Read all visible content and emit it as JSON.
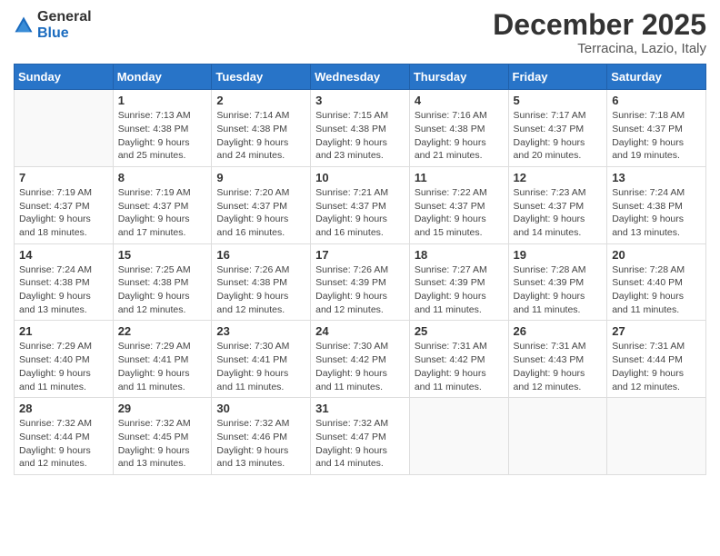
{
  "header": {
    "logo_general": "General",
    "logo_blue": "Blue",
    "month_title": "December 2025",
    "location": "Terracina, Lazio, Italy"
  },
  "days_of_week": [
    "Sunday",
    "Monday",
    "Tuesday",
    "Wednesday",
    "Thursday",
    "Friday",
    "Saturday"
  ],
  "weeks": [
    [
      {
        "day": "",
        "info": ""
      },
      {
        "day": "1",
        "info": "Sunrise: 7:13 AM\nSunset: 4:38 PM\nDaylight: 9 hours\nand 25 minutes."
      },
      {
        "day": "2",
        "info": "Sunrise: 7:14 AM\nSunset: 4:38 PM\nDaylight: 9 hours\nand 24 minutes."
      },
      {
        "day": "3",
        "info": "Sunrise: 7:15 AM\nSunset: 4:38 PM\nDaylight: 9 hours\nand 23 minutes."
      },
      {
        "day": "4",
        "info": "Sunrise: 7:16 AM\nSunset: 4:38 PM\nDaylight: 9 hours\nand 21 minutes."
      },
      {
        "day": "5",
        "info": "Sunrise: 7:17 AM\nSunset: 4:37 PM\nDaylight: 9 hours\nand 20 minutes."
      },
      {
        "day": "6",
        "info": "Sunrise: 7:18 AM\nSunset: 4:37 PM\nDaylight: 9 hours\nand 19 minutes."
      }
    ],
    [
      {
        "day": "7",
        "info": "Sunrise: 7:19 AM\nSunset: 4:37 PM\nDaylight: 9 hours\nand 18 minutes."
      },
      {
        "day": "8",
        "info": "Sunrise: 7:19 AM\nSunset: 4:37 PM\nDaylight: 9 hours\nand 17 minutes."
      },
      {
        "day": "9",
        "info": "Sunrise: 7:20 AM\nSunset: 4:37 PM\nDaylight: 9 hours\nand 16 minutes."
      },
      {
        "day": "10",
        "info": "Sunrise: 7:21 AM\nSunset: 4:37 PM\nDaylight: 9 hours\nand 16 minutes."
      },
      {
        "day": "11",
        "info": "Sunrise: 7:22 AM\nSunset: 4:37 PM\nDaylight: 9 hours\nand 15 minutes."
      },
      {
        "day": "12",
        "info": "Sunrise: 7:23 AM\nSunset: 4:37 PM\nDaylight: 9 hours\nand 14 minutes."
      },
      {
        "day": "13",
        "info": "Sunrise: 7:24 AM\nSunset: 4:38 PM\nDaylight: 9 hours\nand 13 minutes."
      }
    ],
    [
      {
        "day": "14",
        "info": "Sunrise: 7:24 AM\nSunset: 4:38 PM\nDaylight: 9 hours\nand 13 minutes."
      },
      {
        "day": "15",
        "info": "Sunrise: 7:25 AM\nSunset: 4:38 PM\nDaylight: 9 hours\nand 12 minutes."
      },
      {
        "day": "16",
        "info": "Sunrise: 7:26 AM\nSunset: 4:38 PM\nDaylight: 9 hours\nand 12 minutes."
      },
      {
        "day": "17",
        "info": "Sunrise: 7:26 AM\nSunset: 4:39 PM\nDaylight: 9 hours\nand 12 minutes."
      },
      {
        "day": "18",
        "info": "Sunrise: 7:27 AM\nSunset: 4:39 PM\nDaylight: 9 hours\nand 11 minutes."
      },
      {
        "day": "19",
        "info": "Sunrise: 7:28 AM\nSunset: 4:39 PM\nDaylight: 9 hours\nand 11 minutes."
      },
      {
        "day": "20",
        "info": "Sunrise: 7:28 AM\nSunset: 4:40 PM\nDaylight: 9 hours\nand 11 minutes."
      }
    ],
    [
      {
        "day": "21",
        "info": "Sunrise: 7:29 AM\nSunset: 4:40 PM\nDaylight: 9 hours\nand 11 minutes."
      },
      {
        "day": "22",
        "info": "Sunrise: 7:29 AM\nSunset: 4:41 PM\nDaylight: 9 hours\nand 11 minutes."
      },
      {
        "day": "23",
        "info": "Sunrise: 7:30 AM\nSunset: 4:41 PM\nDaylight: 9 hours\nand 11 minutes."
      },
      {
        "day": "24",
        "info": "Sunrise: 7:30 AM\nSunset: 4:42 PM\nDaylight: 9 hours\nand 11 minutes."
      },
      {
        "day": "25",
        "info": "Sunrise: 7:31 AM\nSunset: 4:42 PM\nDaylight: 9 hours\nand 11 minutes."
      },
      {
        "day": "26",
        "info": "Sunrise: 7:31 AM\nSunset: 4:43 PM\nDaylight: 9 hours\nand 12 minutes."
      },
      {
        "day": "27",
        "info": "Sunrise: 7:31 AM\nSunset: 4:44 PM\nDaylight: 9 hours\nand 12 minutes."
      }
    ],
    [
      {
        "day": "28",
        "info": "Sunrise: 7:32 AM\nSunset: 4:44 PM\nDaylight: 9 hours\nand 12 minutes."
      },
      {
        "day": "29",
        "info": "Sunrise: 7:32 AM\nSunset: 4:45 PM\nDaylight: 9 hours\nand 13 minutes."
      },
      {
        "day": "30",
        "info": "Sunrise: 7:32 AM\nSunset: 4:46 PM\nDaylight: 9 hours\nand 13 minutes."
      },
      {
        "day": "31",
        "info": "Sunrise: 7:32 AM\nSunset: 4:47 PM\nDaylight: 9 hours\nand 14 minutes."
      },
      {
        "day": "",
        "info": ""
      },
      {
        "day": "",
        "info": ""
      },
      {
        "day": "",
        "info": ""
      }
    ]
  ]
}
